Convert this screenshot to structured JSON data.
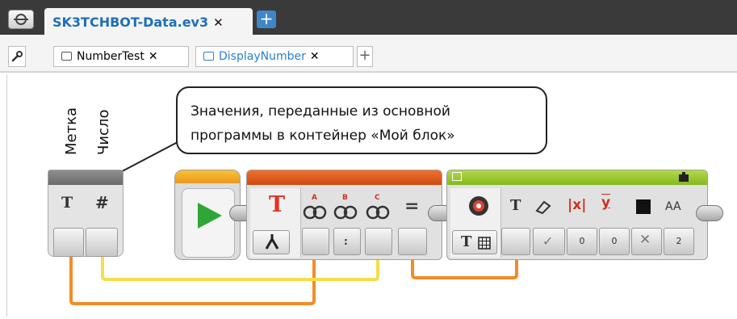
{
  "project_tab": {
    "title": "SK3TCHBOT-Data.ev3",
    "close": "✕",
    "add": "+"
  },
  "program_tabs": {
    "settings_icon": "wrench-icon",
    "tabs": [
      {
        "label": "NumberTest",
        "close": "✕",
        "active": false
      },
      {
        "label": "DisplayNumber",
        "close": "✕",
        "active": true
      }
    ],
    "add": "+"
  },
  "callout": {
    "line1": "Значения, переданные из основной",
    "line2": "программы в контейнер «Мой блок»"
  },
  "params": {
    "label1": "Метка",
    "label2": "Число",
    "type1": "T",
    "type2": "#"
  },
  "text_block": {
    "mode_glyph": "T",
    "sep_a": "A",
    "sep_b": "B",
    "sep_c": "C",
    "equals": "=",
    "b_value": ":"
  },
  "display_block": {
    "mode": "T",
    "inputs": {
      "text": "T",
      "clear": "eraser-icon",
      "x": "x",
      "y": "y",
      "color": "color-icon",
      "font": "AA"
    },
    "values": {
      "clear": "✓",
      "x": "0",
      "y": "0",
      "color": "✕",
      "font": "2"
    }
  },
  "colors": {
    "accent_blue": "#1e6fb8",
    "orange_block": "#e35a13",
    "start_block": "#f3a81b",
    "display_block": "#8dc21f",
    "wire_yellow": "#f7dd4c",
    "wire_orange": "#f28c28"
  }
}
